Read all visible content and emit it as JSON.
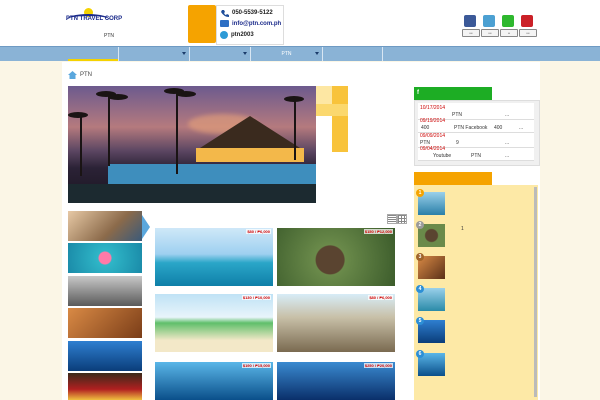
{
  "header": {
    "logo_text": "PTN TRAVEL CORP",
    "logo_sub": "PTN",
    "contact": {
      "phone": "050-5539-5122",
      "email": "info@ptn.com.ph",
      "skype": "ptn2003"
    },
    "social": [
      {
        "name": "facebook-icon",
        "color": "#3b5998",
        "label": "•••"
      },
      {
        "name": "twitter-icon",
        "color": "#4ca0d2",
        "label": "•••"
      },
      {
        "name": "line-icon",
        "color": "#2eb82e",
        "label": "••"
      },
      {
        "name": "pinterest-icon",
        "color": "#cb2027",
        "label": "•••"
      }
    ]
  },
  "nav": {
    "items": [
      {
        "label": "",
        "has_arrow": false
      },
      {
        "label": "",
        "has_arrow": true
      },
      {
        "label": "",
        "has_arrow": true
      },
      {
        "label": "PTN",
        "has_arrow": true
      },
      {
        "label": "",
        "has_arrow": false
      },
      {
        "label": "",
        "has_arrow": false
      }
    ]
  },
  "breadcrumb": {
    "label": "PTN"
  },
  "facebook": {
    "header": "f",
    "posts": [
      {
        "date": "10/17/2014",
        "text": "PTN",
        "more": "..."
      },
      {
        "date": "09/19/2014",
        "text": "400",
        "text2": "PTN Facebook",
        "text3": "400",
        "more": "..."
      },
      {
        "date": "09/09/2014",
        "text": "PTN",
        "text2": "9",
        "more": "..."
      },
      {
        "date": "09/04/2014",
        "text": "Youtube",
        "text2": "PTN",
        "more": "..."
      }
    ]
  },
  "ranking": {
    "items": [
      {
        "num": "1",
        "color": "#f5a300",
        "text": ""
      },
      {
        "num": "2",
        "color": "#9a9a9a",
        "text": "1"
      },
      {
        "num": "3",
        "color": "#a0642a",
        "text": ""
      },
      {
        "num": "4",
        "color": "#2d8fd6",
        "text": ""
      },
      {
        "num": "5",
        "color": "#2d8fd6",
        "text": ""
      },
      {
        "num": "6",
        "color": "#2d8fd6",
        "text": ""
      }
    ]
  },
  "cards": [
    {
      "price": "$80 / ₱6,000",
      "name": "card-island"
    },
    {
      "price": "$150 / ₱12,000",
      "name": "card-tarsier"
    },
    {
      "price": "$130 / ₱10,000",
      "name": "card-beach"
    },
    {
      "price": "$80 / ₱6,000",
      "name": "card-church"
    },
    {
      "price": "$190 / ₱15,000",
      "name": "card-whaleshark"
    },
    {
      "price": "$250 / ₱20,000",
      "name": "card-whaleshark2"
    }
  ]
}
